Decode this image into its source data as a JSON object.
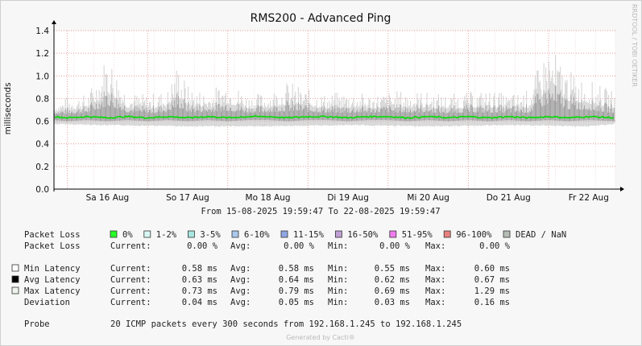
{
  "chart_data": {
    "type": "area",
    "title": "RMS200 - Advanced Ping",
    "ylabel": "milliseconds",
    "watermark": "RRDTOOL / TOBI OETIKER",
    "ylim": [
      0,
      1.4
    ],
    "yticks": [
      0.0,
      0.2,
      0.4,
      0.6,
      0.8,
      1.0,
      1.2,
      1.4
    ],
    "ytick_labels": [
      "0.0",
      "0.2",
      "0.4",
      "0.6",
      "0.8",
      "1.0",
      "1.2",
      "1.4"
    ],
    "xlim": [
      "2025-08-15 19:59:47",
      "2025-08-22 19:59:47"
    ],
    "xticks": [
      {
        "label": "Sa 16 Aug",
        "time": "2025-08-16 12:00"
      },
      {
        "label": "So 17 Aug",
        "time": "2025-08-17 12:00"
      },
      {
        "label": "Mo 18 Aug",
        "time": "2025-08-18 12:00"
      },
      {
        "label": "Di 19 Aug",
        "time": "2025-08-19 12:00"
      },
      {
        "label": "Mi 20 Aug",
        "time": "2025-08-20 12:00"
      },
      {
        "label": "Do 21 Aug",
        "time": "2025-08-21 12:00"
      },
      {
        "label": "Fr 22 Aug",
        "time": "2025-08-22 12:00"
      }
    ],
    "grid": true,
    "time_range_text": "From 15-08-2025 19:59:47 To 22-08-2025 19:59:47",
    "series": [
      {
        "name": "Avg Latency",
        "color": "#00dd00",
        "x": [
          "2025-08-15 20:00",
          "2025-08-16 00:00",
          "2025-08-16 06:00",
          "2025-08-16 12:00",
          "2025-08-16 18:00",
          "2025-08-17 00:00",
          "2025-08-17 06:00",
          "2025-08-17 12:00",
          "2025-08-17 18:00",
          "2025-08-18 00:00",
          "2025-08-18 06:00",
          "2025-08-18 12:00",
          "2025-08-18 18:00",
          "2025-08-19 00:00",
          "2025-08-19 06:00",
          "2025-08-19 12:00",
          "2025-08-19 18:00",
          "2025-08-20 00:00",
          "2025-08-20 06:00",
          "2025-08-20 12:00",
          "2025-08-20 18:00",
          "2025-08-21 00:00",
          "2025-08-21 06:00",
          "2025-08-21 12:00",
          "2025-08-21 18:00",
          "2025-08-22 00:00",
          "2025-08-22 06:00",
          "2025-08-22 12:00",
          "2025-08-22 19:55"
        ],
        "y": [
          0.64,
          0.63,
          0.64,
          0.63,
          0.64,
          0.63,
          0.64,
          0.63,
          0.64,
          0.63,
          0.64,
          0.64,
          0.63,
          0.64,
          0.64,
          0.63,
          0.64,
          0.64,
          0.63,
          0.64,
          0.63,
          0.64,
          0.63,
          0.64,
          0.63,
          0.64,
          0.63,
          0.64,
          0.63
        ]
      },
      {
        "name": "Max Latency",
        "color": "#333333",
        "x": [
          "2025-08-15 20:00",
          "2025-08-16 00:00",
          "2025-08-16 06:00",
          "2025-08-16 10:00",
          "2025-08-16 12:00",
          "2025-08-16 18:00",
          "2025-08-17 00:00",
          "2025-08-17 06:00",
          "2025-08-17 09:00",
          "2025-08-17 12:00",
          "2025-08-17 18:00",
          "2025-08-18 00:00",
          "2025-08-18 06:00",
          "2025-08-18 12:00",
          "2025-08-18 18:00",
          "2025-08-19 00:00",
          "2025-08-19 06:00",
          "2025-08-19 12:00",
          "2025-08-19 18:00",
          "2025-08-20 00:00",
          "2025-08-20 06:00",
          "2025-08-20 12:00",
          "2025-08-20 18:00",
          "2025-08-21 00:00",
          "2025-08-21 06:00",
          "2025-08-21 12:00",
          "2025-08-21 18:00",
          "2025-08-22 00:00",
          "2025-08-22 06:00",
          "2025-08-22 19:55"
        ],
        "y": [
          0.76,
          0.82,
          0.84,
          1.08,
          1.24,
          0.86,
          0.84,
          0.88,
          1.14,
          0.92,
          0.86,
          0.98,
          0.84,
          0.86,
          0.96,
          0.88,
          0.84,
          0.88,
          0.84,
          0.86,
          0.88,
          0.86,
          0.84,
          0.86,
          0.88,
          0.84,
          0.88,
          1.29,
          1.05,
          0.86
        ]
      },
      {
        "name": "Min Latency",
        "color": "#888888",
        "x": [
          "2025-08-15 20:00",
          "2025-08-16 12:00",
          "2025-08-17 12:00",
          "2025-08-18 12:00",
          "2025-08-19 12:00",
          "2025-08-20 12:00",
          "2025-08-21 12:00",
          "2025-08-22 12:00",
          "2025-08-22 19:55"
        ],
        "y": [
          0.58,
          0.57,
          0.56,
          0.56,
          0.57,
          0.56,
          0.57,
          0.56,
          0.58
        ]
      }
    ],
    "legend": {
      "loss_label": "Packet Loss",
      "loss_items": [
        {
          "label": "0%",
          "color": "#26ff26"
        },
        {
          "label": "1-2%",
          "color": "#d8f7f4"
        },
        {
          "label": "3-5%",
          "color": "#a8e6e0"
        },
        {
          "label": "6-10%",
          "color": "#a9c9ec"
        },
        {
          "label": "11-15%",
          "color": "#8fa7e4"
        },
        {
          "label": "16-50%",
          "color": "#c0a0d4"
        },
        {
          "label": "51-95%",
          "color": "#f07cf0"
        },
        {
          "label": "96-100%",
          "color": "#e98080"
        },
        {
          "label": "DEAD / NaN",
          "color": "#b4bcb4"
        }
      ]
    },
    "stats": {
      "header": {
        "current": "Current:",
        "avg": "Avg:",
        "min": "Min:",
        "max": "Max:"
      },
      "rows": [
        {
          "label": "Packet Loss",
          "swatch": null,
          "current": "0.00 %",
          "avg": "0.00 %",
          "min": "0.00 %",
          "max": "0.00 %"
        },
        {
          "label": "Min Latency",
          "swatch": "#ffffff",
          "current": "0.58 ms",
          "avg": "0.58 ms",
          "min": "0.55 ms",
          "max": "0.60 ms"
        },
        {
          "label": "Avg Latency",
          "swatch": "#000000",
          "current": "0.63 ms",
          "avg": "0.64 ms",
          "min": "0.62 ms",
          "max": "0.67 ms"
        },
        {
          "label": "Max Latency",
          "swatch": "#eef3ee",
          "current": "0.73 ms",
          "avg": "0.79 ms",
          "min": "0.69 ms",
          "max": "1.29 ms"
        },
        {
          "label": "Deviation",
          "swatch": null,
          "current": "0.04 ms",
          "avg": "0.05 ms",
          "min": "0.03 ms",
          "max": "0.16 ms"
        }
      ]
    },
    "probe": {
      "label": "Probe",
      "text": "20 ICMP packets every 300 seconds from 192.168.1.245 to 192.168.1.245"
    },
    "footer": "Generated by Cacti®"
  }
}
